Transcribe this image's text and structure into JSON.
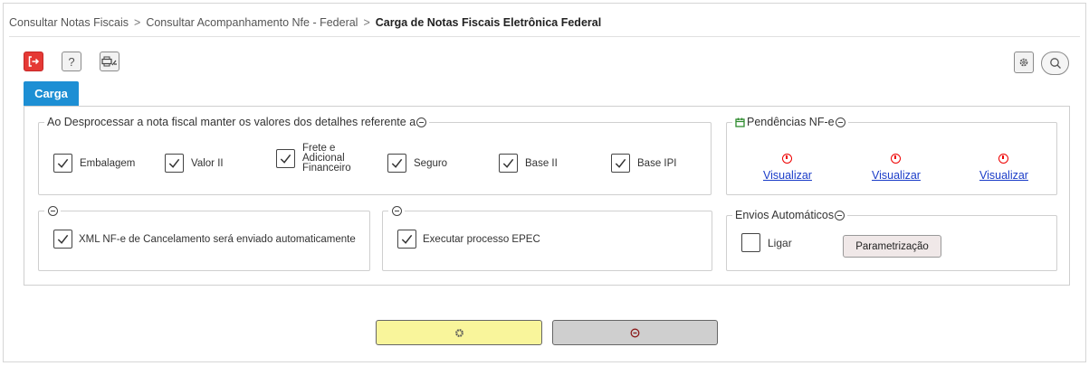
{
  "breadcrumb": {
    "items": [
      "Consultar Notas Fiscais",
      "Consultar Acompanhamento Nfe - Federal"
    ],
    "separator": ">",
    "current": "Carga de Notas Fiscais Eletrônica Federal"
  },
  "toolbar": {
    "exit_icon": "exit-icon",
    "help_label": "?",
    "print_icon": "printer-settings-icon",
    "settings_icon": "gear-icon",
    "search_icon": "search-icon"
  },
  "tab": {
    "label": "Carga"
  },
  "detalhes": {
    "legend": "Ao Desprocessar a nota fiscal manter os valores dos detalhes referente a",
    "items": [
      {
        "label": "Embalagem",
        "checked": true
      },
      {
        "label": "Valor II",
        "checked": true
      },
      {
        "label": "Frete e Adicional Financeiro",
        "checked": true
      },
      {
        "label": "Seguro",
        "checked": true
      },
      {
        "label": "Base II",
        "checked": true
      },
      {
        "label": "Base IPI",
        "checked": true
      }
    ]
  },
  "pendencias": {
    "legend": "Pendências NF-e",
    "icon": "calendar-icon",
    "links": [
      "Visualizar",
      "Visualizar",
      "Visualizar"
    ]
  },
  "cancelamento": {
    "label": "XML NF-e de Cancelamento será enviado automaticamente",
    "checked": true
  },
  "epec": {
    "label": "Executar processo EPEC",
    "checked": true
  },
  "envios": {
    "legend": "Envios Automáticos",
    "ligar_label": "Ligar",
    "ligar_checked": false,
    "param_label": "Parametrização"
  },
  "actions": {
    "execute_icon": "gear-icon",
    "cancel_icon": "cancel-icon",
    "colors": {
      "execute": "#f9f59b",
      "cancel": "#cfcfcf",
      "tab": "#1d8fd4",
      "exit": "#e53935"
    }
  }
}
